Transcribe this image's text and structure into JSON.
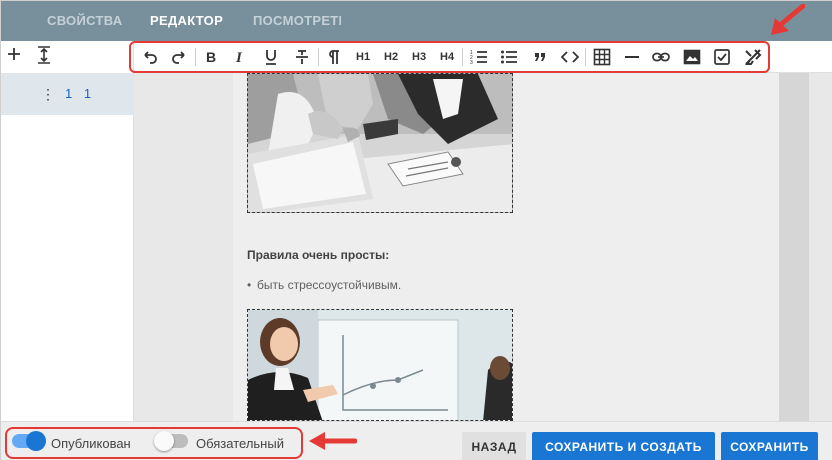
{
  "tabs": [
    {
      "label": "СВОЙСТВА"
    },
    {
      "label": "РЕДАКТОР"
    },
    {
      "label": "ПОСМОТРЕТЬ"
    }
  ],
  "sidebar": {
    "item_label": "1 1",
    "item_menu_icon": "more-vert-icon",
    "add_icon": "plus-icon",
    "expand_icon": "vertical-expand-icon"
  },
  "toolbar": {
    "h1": "H1",
    "h2": "H2",
    "h3": "H3",
    "h4": "H4",
    "icons": [
      "undo-icon",
      "redo-icon",
      "bold-icon",
      "italic-icon",
      "underline-icon",
      "strikethrough-icon",
      "paragraph-icon",
      "ordered-list-icon",
      "bullet-list-icon",
      "quote-icon",
      "code-icon",
      "table-icon",
      "horizontal-rule-icon",
      "link-icon",
      "image-icon",
      "checkbox-icon",
      "clear-format-icon"
    ]
  },
  "content": {
    "heading": "Правила очень просты:",
    "bullets": [
      "быть стрессоустойчивым."
    ]
  },
  "bottom": {
    "published_label": "Опубликован",
    "required_label": "Обязательный",
    "back_button": "НАЗАД",
    "save_create_button": "СОХРАНИТЬ И СОЗДАТЬ",
    "save_button": "СОХРАНИТЬ"
  },
  "colors": {
    "tab_bar": "#78909c",
    "primary": "#1976d2",
    "highlight": "#e53935"
  }
}
